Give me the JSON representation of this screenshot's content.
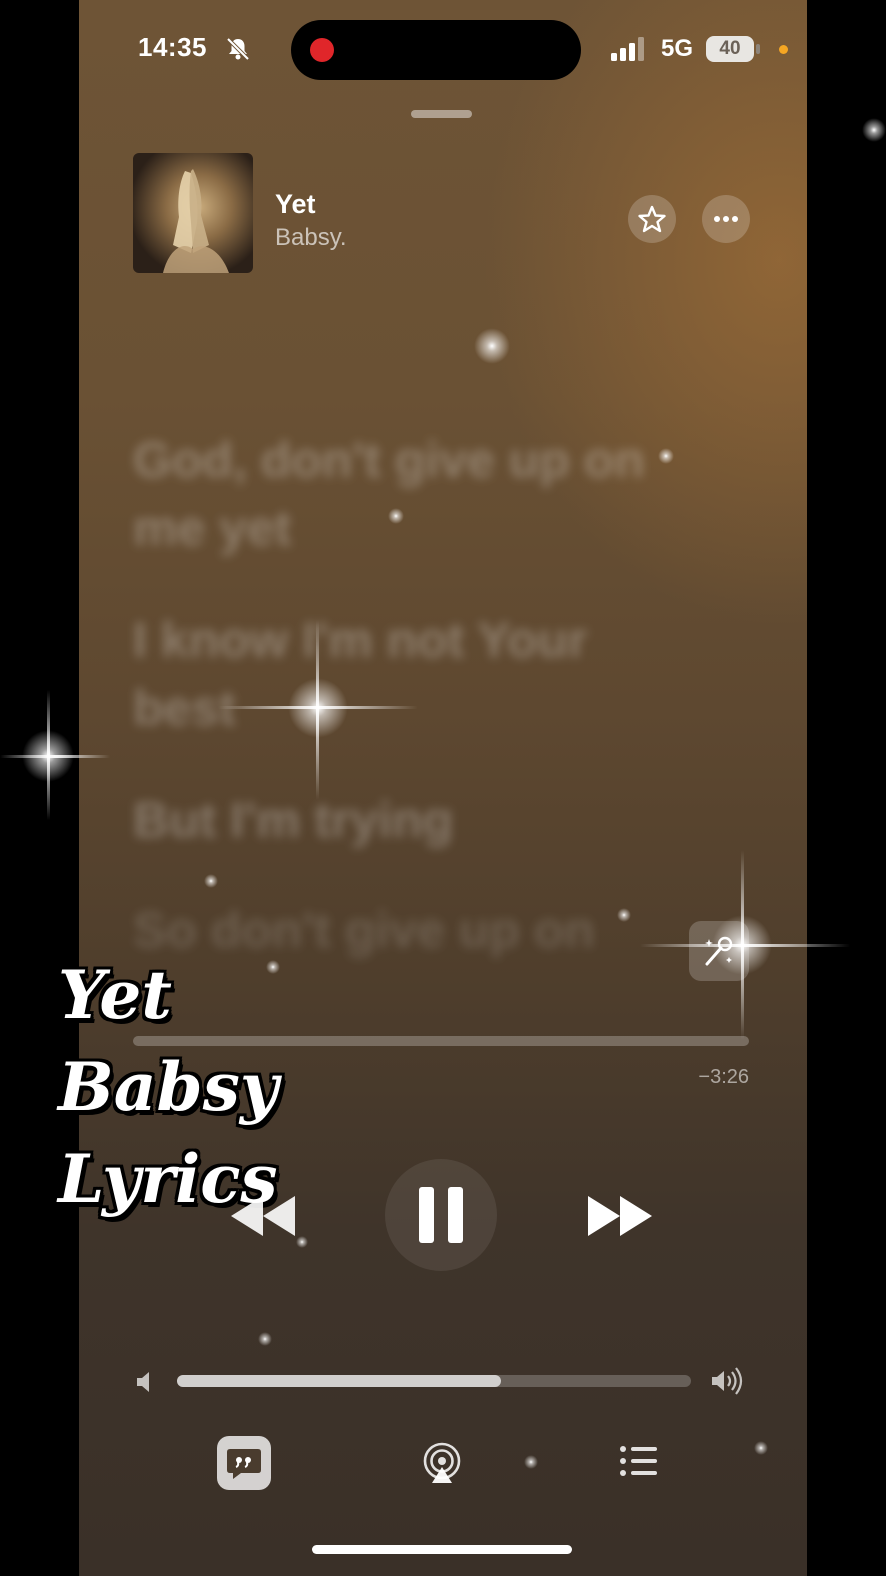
{
  "status_bar": {
    "time": "14:35",
    "network": "5G",
    "battery": "40",
    "icons": [
      "bell-slash-icon",
      "cellular-signal-icon",
      "battery-icon",
      "privacy-indicator-dot"
    ]
  },
  "now_playing": {
    "title": "Yet",
    "artist": "Babsy.",
    "favorite_icon": "star-icon",
    "more_icon": "ellipsis-icon"
  },
  "lyrics": {
    "lines": [
      "God, don't give up on",
      "me yet",
      "I know I'm not Your",
      "best",
      "But I'm trying",
      "So don't give up on"
    ]
  },
  "overlay": {
    "line1": "Yet",
    "line2": "Babsy",
    "line3": "Lyrics"
  },
  "playback": {
    "time_remaining": "−3:26",
    "progress_fraction": 0.0,
    "controls": [
      "rewind-icon",
      "pause-icon",
      "fast-forward-icon"
    ]
  },
  "volume": {
    "level_fraction": 0.63
  },
  "bottom_bar": {
    "icons": [
      "lyrics-quote-icon",
      "airplay-icon",
      "queue-list-icon"
    ]
  },
  "colors": {
    "background_top": "#6e5436",
    "background_bottom": "#3a3028",
    "record_indicator": "#e0262a",
    "privacy_dot": "#f5a623"
  }
}
